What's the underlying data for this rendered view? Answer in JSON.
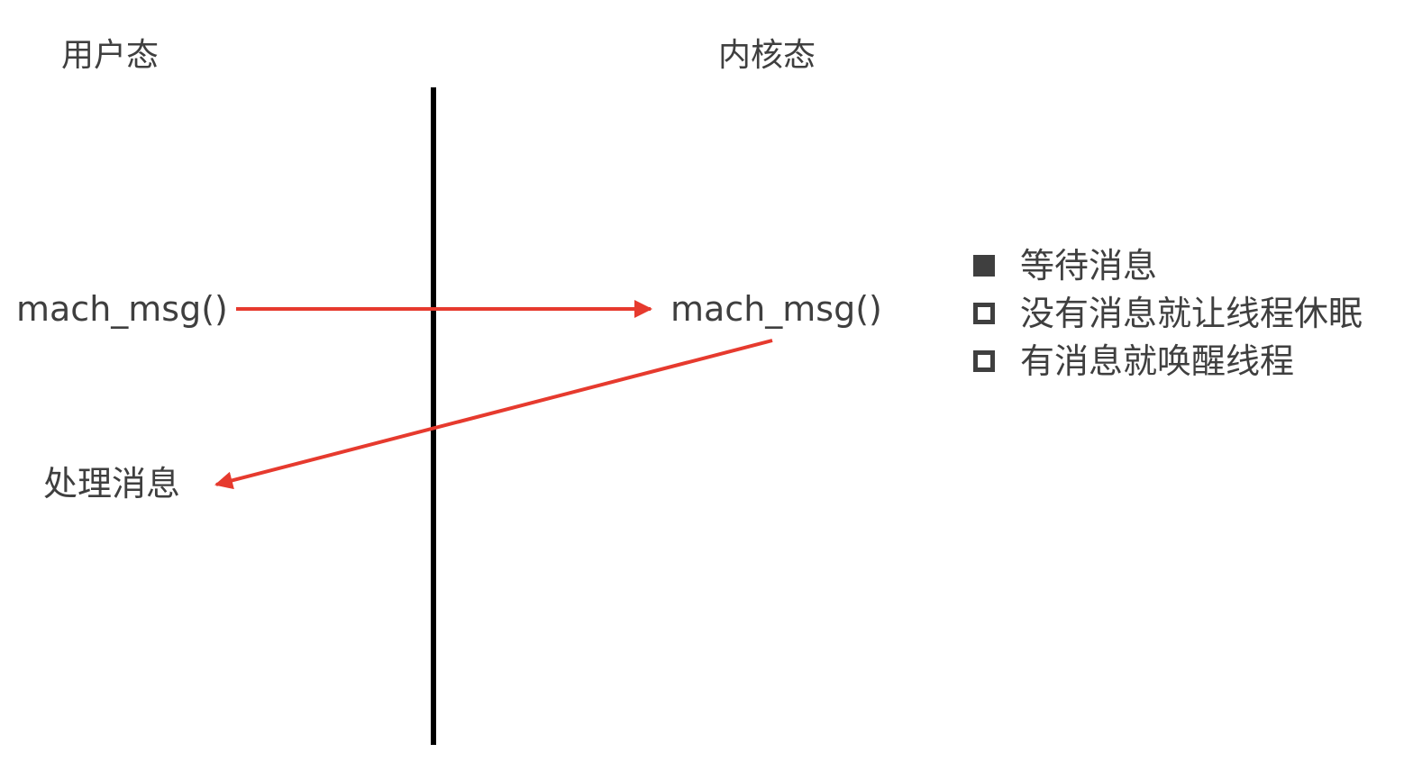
{
  "columns": {
    "user_mode": "用户态",
    "kernel_mode": "内核态"
  },
  "nodes": {
    "user_call": "mach_msg()",
    "kernel_call": "mach_msg()",
    "handle_message": "处理消息"
  },
  "kernel_actions": [
    {
      "marker": "filled",
      "text": "等待消息"
    },
    {
      "marker": "hollow",
      "text": "没有消息就让线程休眠"
    },
    {
      "marker": "hollow",
      "text": "有消息就唤醒线程"
    }
  ],
  "colors": {
    "text": "#3f3f3f",
    "divider": "#000000",
    "arrow": "#e63a2e"
  }
}
